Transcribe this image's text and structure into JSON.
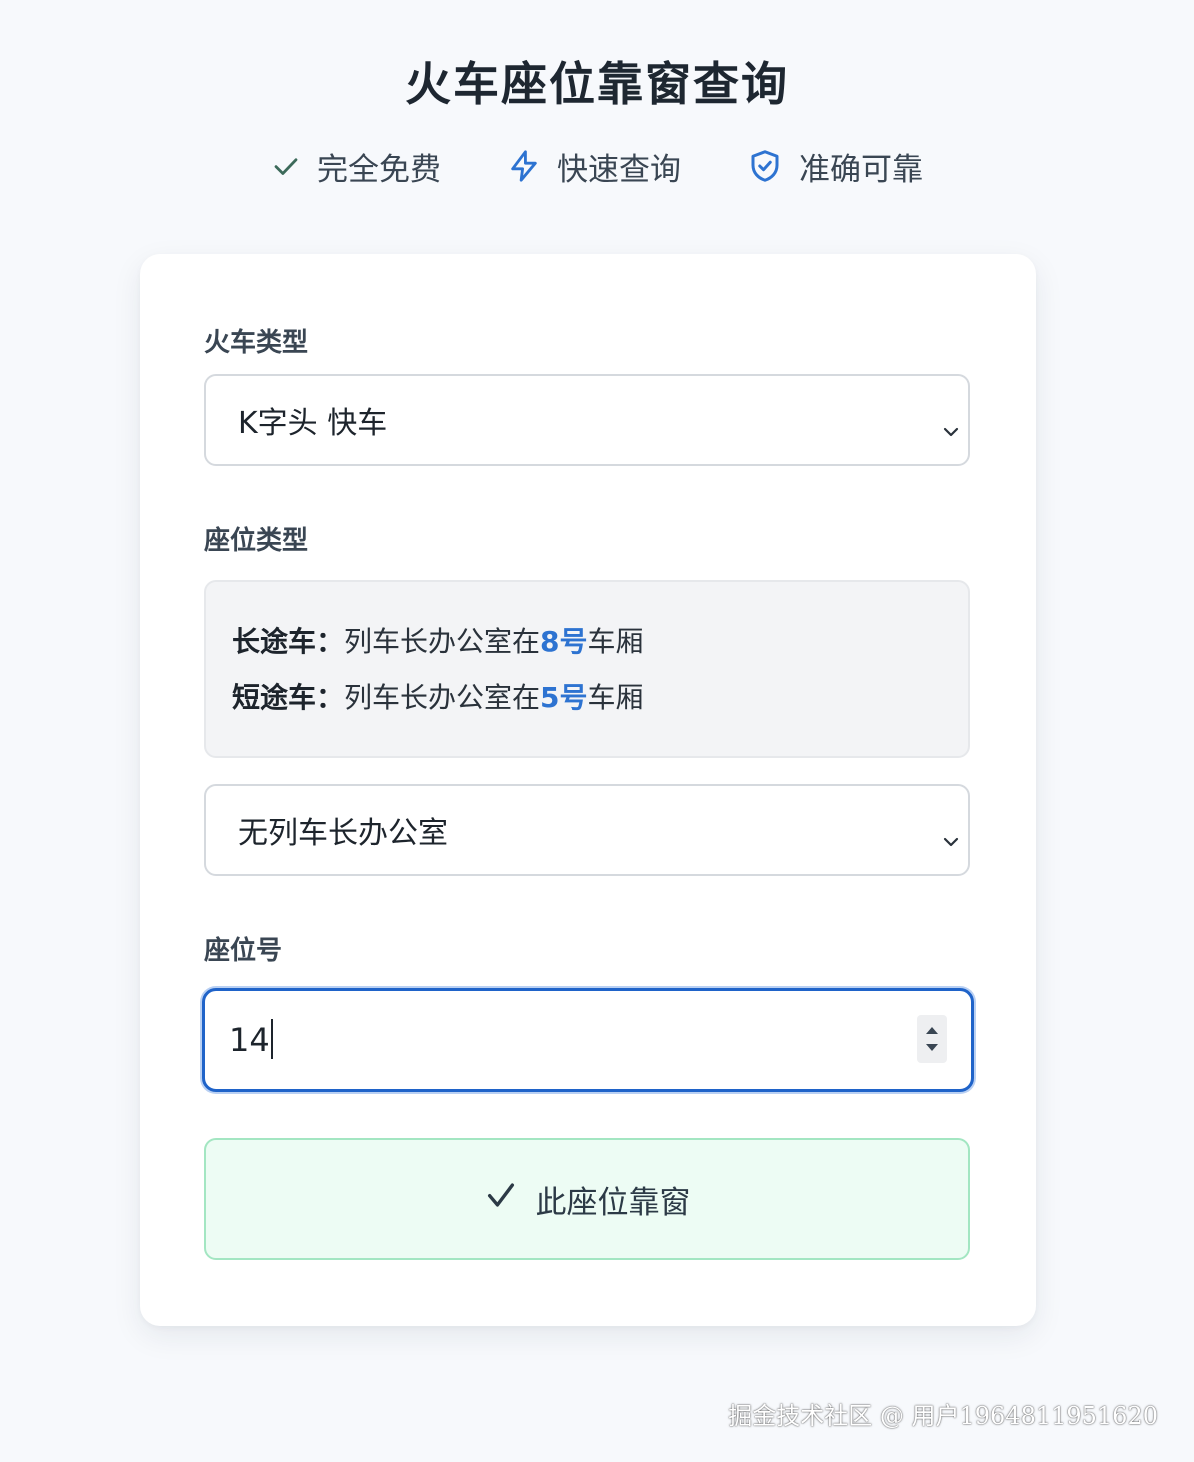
{
  "page": {
    "title": "火车座位靠窗查询"
  },
  "features": [
    {
      "icon": "check-icon",
      "label": "完全免费",
      "color": "#3c6a5a"
    },
    {
      "icon": "lightning-icon",
      "label": "快速查询",
      "color": "#2d73d1"
    },
    {
      "icon": "shield-check-icon",
      "label": "准确可靠",
      "color": "#2d73d1"
    }
  ],
  "form": {
    "train_type": {
      "label": "火车类型",
      "selected": "K字头 快车"
    },
    "seat_type": {
      "label": "座位类型",
      "info": {
        "long_label": "长途车：",
        "long_text": "列车长办公室在",
        "long_num": "8号",
        "long_suffix": "车厢",
        "short_label": "短途车：",
        "short_text": "列车长办公室在",
        "short_num": "5号",
        "short_suffix": "车厢"
      },
      "selected": "无列车长办公室"
    },
    "seat_number": {
      "label": "座位号",
      "value": "14"
    },
    "result": {
      "icon": "check-icon",
      "text": "此座位靠窗"
    }
  },
  "watermark": "掘金技术社区 @ 用户1964811951620",
  "colors": {
    "accent": "#1f63c9",
    "highlight": "#2d73d1",
    "success_bg": "#edfcf4",
    "success_border": "#a3e6c2"
  }
}
